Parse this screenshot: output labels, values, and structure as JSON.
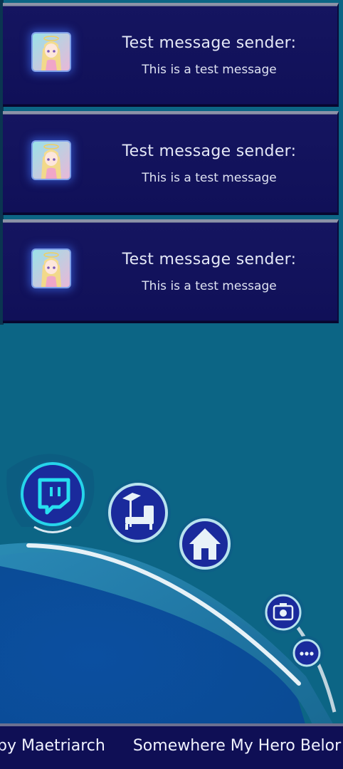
{
  "messages": [
    {
      "sender": "Test message sender:",
      "text": "This is a test message",
      "avatar_icon": "anime-girl-avatar"
    },
    {
      "sender": "Test message sender:",
      "text": "This is a test message",
      "avatar_icon": "anime-girl-avatar"
    },
    {
      "sender": "Test message sender:",
      "text": "This is a test message",
      "avatar_icon": "anime-girl-avatar"
    }
  ],
  "dock": {
    "icons": [
      "twitch-icon",
      "chair-icon",
      "home-icon",
      "camera-icon",
      "more-icon"
    ]
  },
  "ticker": {
    "items": [
      "by Maetriarch",
      "Somewhere My Hero Belor"
    ]
  },
  "colors": {
    "background": "#0c6585",
    "card": "#131360",
    "accent": "#27e0f0",
    "dock_blue": "#1a2a9c"
  }
}
